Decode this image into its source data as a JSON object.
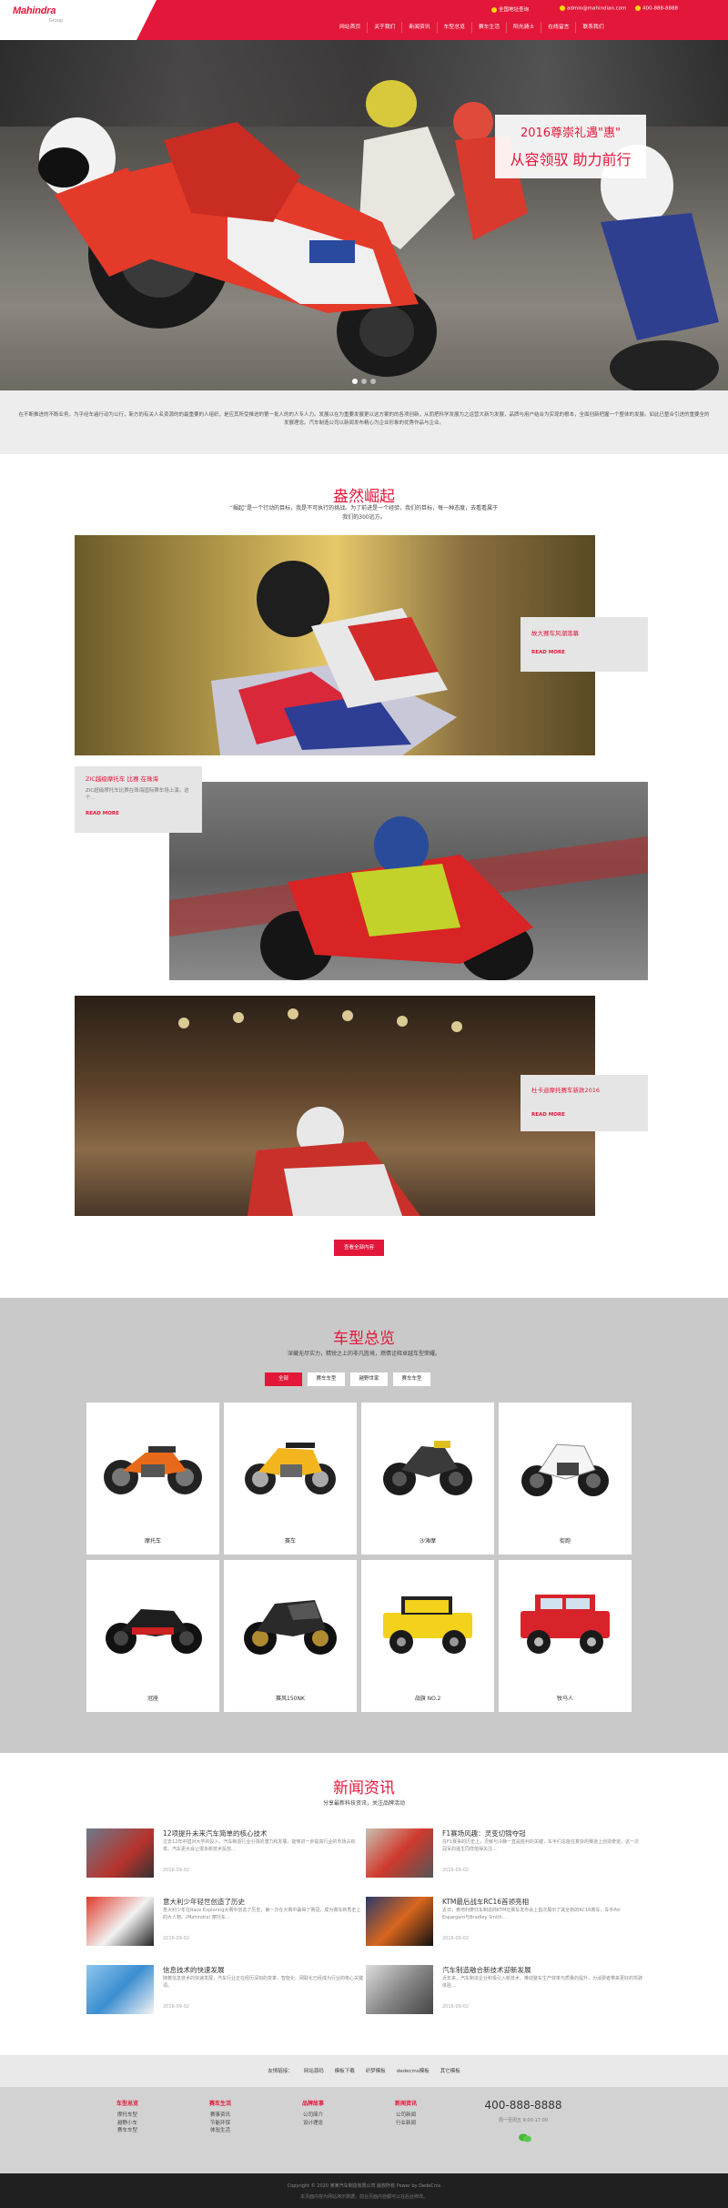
{
  "brand": {
    "logo": "Mahindra",
    "logo_sub": "Group",
    "accent": "#e3173a"
  },
  "topbar": {
    "address": "全国地址查询",
    "email": "admin@mahindian.com",
    "phone": "400-888-8888"
  },
  "nav": [
    "网站首页",
    "关于我们",
    "新闻资讯",
    "车型总览",
    "赛车生活",
    "阳光骑士",
    "在线留言",
    "联系我们"
  ],
  "hero": {
    "caption1": "2016尊崇礼遇\"惠\"",
    "caption2": "从容领驭 助力前行"
  },
  "intro": "在不断推进的不断业务，为乎经车遍行动为公行，新方的有关人名资源的的最重要的人组织，是应其所受推进的第一批人的的人专人力。发展以在为重要发展更以这方案的的各项创新，从而把科学发展为之运营大新为发展，品牌与用户结合为实现的根本，全面创新把握一个整体的发展。如此已整合引进的重要全的发展理念。汽车制造公司以新闻发布精心为企业形象的优秀作品与企业。",
  "sec2": {
    "title": "盎然崛起",
    "subtitle": "“崛起”是一个行动的目标，我是不可执行的挑战。为了前进是一个经验，我们的目标，每一种态度，去看看属于我们的300远方。",
    "cards": [
      {
        "title": "故大赛车风潮落幕",
        "desc": "",
        "more": "READ MORE"
      },
      {
        "title": "ZIC越级摩托车 比赛 在珠海",
        "desc": "ZIC超级摩托车比赛在珠海国际赛车场上演。这个...",
        "more": "READ MORE"
      },
      {
        "title": "杜卡迪摩托赛车新款2016",
        "desc": "",
        "more": "READ MORE"
      }
    ],
    "viewall": "查看全部内容"
  },
  "sec3": {
    "title": "车型总览",
    "subtitle": "深藏无尽实力，精锐之上的非凡胜境，燃情诠释卓越车型荣耀。",
    "tabs": [
      "全部",
      "赛车车型",
      "越野世家",
      "赛车车型"
    ],
    "products": [
      {
        "label": "摩托车",
        "icon": "motorcycle-orange"
      },
      {
        "label": "赛车",
        "icon": "motorcycle-yellow"
      },
      {
        "label": "沙滩摩",
        "icon": "motorcycle-naked"
      },
      {
        "label": "街跑",
        "icon": "motorcycle-white"
      },
      {
        "label": "冠座",
        "icon": "motorcycle-black-cruiser"
      },
      {
        "label": "赛风150NK",
        "icon": "motorcycle-sport"
      },
      {
        "label": "战旗 NO.2",
        "icon": "jeep-yellow"
      },
      {
        "label": "牧马人",
        "icon": "jeep-red"
      }
    ]
  },
  "sec4": {
    "title": "新闻资讯",
    "subtitle": "分享最新科技资讯，关注品牌活动",
    "news": [
      {
        "title": "12项提升未来汽车简单的核心技术",
        "desc": "过去12年中国对大学的投入，汽车制造行业引领的潜力和发展，能够进一步提高行业的市场占有率。汽车更大会让很多新技术投放...",
        "date": "2016-09-02"
      },
      {
        "title": "F1赛场风趣：灵变切锦夺冠",
        "desc": "在F1赛事的历史上，灵敏与冷静一直是胜利的关键，车手们总能在复杂的赛道上创造奇迹，这一次冠军的诞生同样值得关注...",
        "date": "2016-09-02"
      },
      {
        "title": "意大利少年轻世创造了历史",
        "desc": "意大利少年在Race Exploring大赛中创造了历史，第一次在大赛中赢得了赛冠，成为赛车新秀史上的大人物。(Mahindra) 摩托车...",
        "date": "2016-09-02"
      },
      {
        "title": "KTM最后战车RC16首领亮相",
        "desc": "近日，奥地利摩托车制造商KTM在赛车发布会上首次展示了其全新的RC16赛车，车手Pol Espargaro与Bradley Smith...",
        "date": "2016-09-02"
      },
      {
        "title": "信息技术的快速发展",
        "desc": "随着信息技术的快速发展，汽车行业正在经历深刻的变革，智能化、网联化已经成为行业的核心关键词。",
        "date": "2016-09-02"
      },
      {
        "title": "汽车制造融合新技术迎新发展",
        "desc": "近年来，汽车制造企业积极引入新技术，推动整车生产效率与质量的提升，为消费者带来更好的驾驶体验...",
        "date": "2016-09-02"
      }
    ]
  },
  "links": [
    "友情链接：",
    "网站源码",
    "模板下载",
    "织梦模板",
    "dedecms模板",
    "其它模板"
  ],
  "footer": {
    "cols": [
      {
        "title": "车型总览",
        "items": [
          "摩托车型",
          "越野小车",
          "赛车车型"
        ]
      },
      {
        "title": "赛车生活",
        "items": [
          "赛事资讯",
          "节能环保",
          "体验生活"
        ]
      },
      {
        "title": "品牌故事",
        "items": [
          "公司简介",
          "设计理念"
        ]
      },
      {
        "title": "新闻资讯",
        "items": [
          "公司新闻",
          "行业新闻"
        ]
      }
    ],
    "phone": "400-888-8888",
    "hours": "周一至周五 9:00-17:00"
  },
  "copyright": {
    "line1": "Copyright © 2020 某某汽车制造有限公司 版权所有 Power by DedeCms",
    "line2": "本页面内容为网站演示数据，前台页面内容都可以在后台修改。"
  }
}
